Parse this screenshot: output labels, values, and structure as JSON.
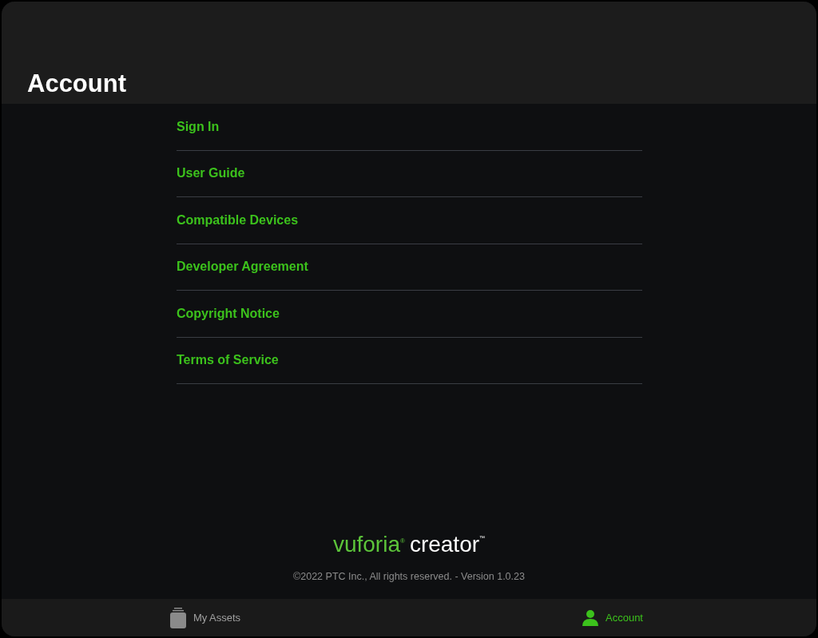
{
  "header": {
    "title": "Account"
  },
  "menu": [
    {
      "label": "Sign In"
    },
    {
      "label": "User Guide"
    },
    {
      "label": "Compatible Devices"
    },
    {
      "label": "Developer Agreement"
    },
    {
      "label": "Copyright Notice"
    },
    {
      "label": "Terms of Service"
    }
  ],
  "footer": {
    "logo": {
      "brand": "vuforia",
      "brand_mark": "®",
      "product": "creator",
      "product_mark": "™"
    },
    "copyright": "©2022 PTC Inc., All rights reserved. - Version 1.0.23"
  },
  "tab_bar": [
    {
      "kind": "assets",
      "label": "My Assets",
      "selected": false
    },
    {
      "kind": "account",
      "label": "Account",
      "selected": true
    }
  ]
}
